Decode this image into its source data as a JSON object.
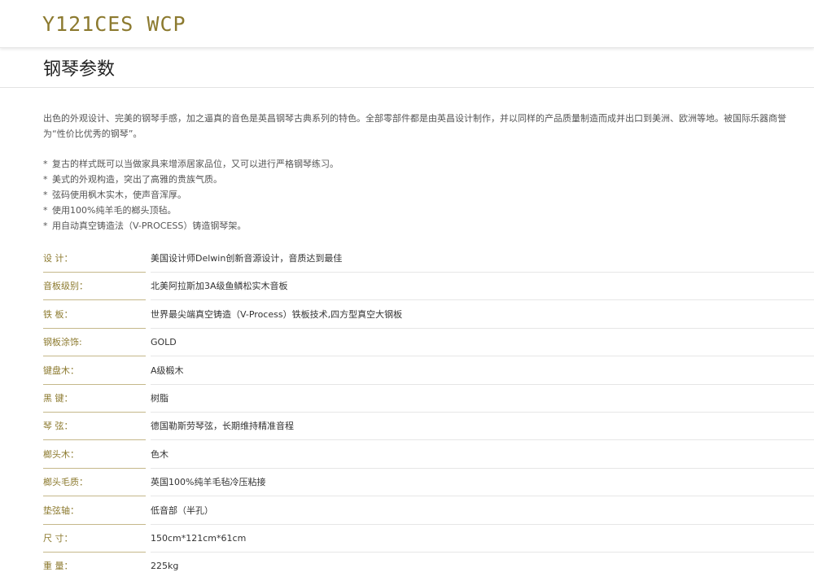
{
  "header": {
    "model": "Y121CES WCP"
  },
  "section": {
    "title": "钢琴参数"
  },
  "intro": "出色的外观设计、完美的钢琴手感，加之逼真的音色是英昌钢琴古典系列的特色。全部零部件都是由英昌设计制作，并以同样的产品质量制造而成并出口到美洲、欧洲等地。被国际乐器商誉为“性价比优秀的钢琴”。",
  "features": [
    "复古的样式既可以当做家具来增添居家品位，又可以进行严格钢琴练习。",
    "美式的外观构造，突出了高雅的贵族气质。",
    "弦码使用枫木实木，使声音浑厚。",
    "使用100%纯羊毛的榔头顶毡。",
    "用自动真空铸造法（V-PROCESS）铸造钢琴架。"
  ],
  "feature_marker": "*",
  "specs": [
    {
      "label": "设 计：",
      "value": "美国设计师Delwin创新音源设计，音质达到最佳"
    },
    {
      "label": "音板级别：",
      "value": "北美阿拉斯加3A级鱼鳞松实木音板"
    },
    {
      "label": "铁 板：",
      "value": "世界最尖端真空铸造（V-Process）铁板技术,四方型真空大钢板"
    },
    {
      "label": "钢板涂饰:",
      "value": "GOLD"
    },
    {
      "label": "键盘木：",
      "value": "A级椴木"
    },
    {
      "label": "黑 键：",
      "value": "树脂"
    },
    {
      "label": "琴 弦：",
      "value": "德国勒斯劳琴弦，长期维持精准音程"
    },
    {
      "label": "榔头木：",
      "value": "色木"
    },
    {
      "label": "榔头毛质：",
      "value": "英国100%纯羊毛毡冷压粘接"
    },
    {
      "label": "垫弦轴：",
      "value": "低音部（半孔）"
    },
    {
      "label": "尺 寸：",
      "value": "150cm*121cm*61cm"
    },
    {
      "label": "重 量：",
      "value": "225kg"
    }
  ],
  "colors": {
    "accent": "#8c7a2f",
    "label_rule": "#c5b88a",
    "divider": "#e6e6e6"
  }
}
